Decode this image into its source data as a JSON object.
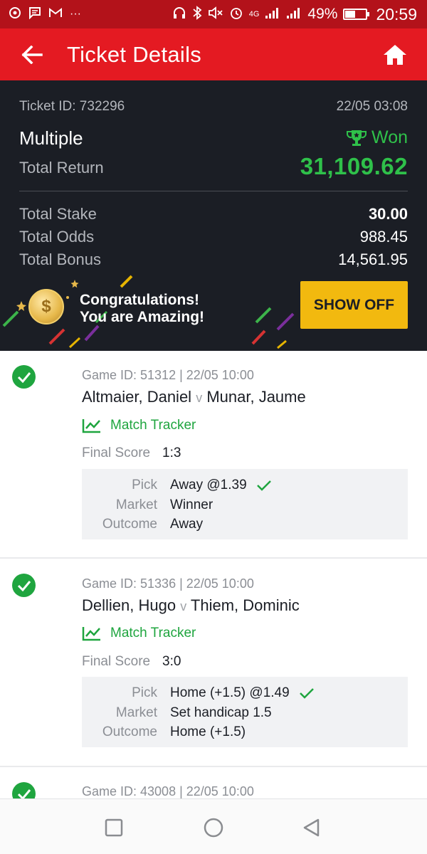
{
  "status_bar": {
    "network": "4G",
    "battery_pct": "49%",
    "battery_level": 0.49,
    "time": "20:59",
    "icons_left": [
      "sync-icon",
      "message-icon",
      "gmail-icon",
      "more-icon"
    ],
    "icons_right": [
      "headset-icon",
      "bluetooth-icon",
      "mute-icon",
      "alarm-icon",
      "signal-icon",
      "signal-icon",
      "battery-icon"
    ]
  },
  "header": {
    "title": "Ticket Details",
    "back_icon": "arrow-left-icon",
    "home_icon": "home-icon"
  },
  "ticket": {
    "id_label": "Ticket ID: 732296",
    "datetime": "22/05 03:08",
    "bet_type": "Multiple",
    "status": "Won",
    "status_icon": "trophy-icon",
    "total_return_label": "Total Return",
    "total_return": "31,109.62",
    "total_stake_label": "Total Stake",
    "total_stake": "30.00",
    "total_odds_label": "Total Odds",
    "total_odds": "988.45",
    "total_bonus_label": "Total Bonus",
    "total_bonus": "14,561.95"
  },
  "banner": {
    "line1": "Congratulations!",
    "line2": "You are Amazing!",
    "button": "SHOW OFF",
    "coin_icon": "coin-icon"
  },
  "colors": {
    "brand_red": "#e41a22",
    "dark_bg": "#1b1e25",
    "won_green": "#2fc14a",
    "accent_yellow": "#f2b90f"
  },
  "selections": [
    {
      "game_id": "Game ID: 51312 | 22/05 10:00",
      "home": "Altmaier, Daniel",
      "vs": "v",
      "away": "Munar, Jaume",
      "tracker": "Match Tracker",
      "final_score_label": "Final Score",
      "final_score": "1:3",
      "pick_label": "Pick",
      "pick": "Away @1.39",
      "market_label": "Market",
      "market": "Winner",
      "outcome_label": "Outcome",
      "outcome": "Away"
    },
    {
      "game_id": "Game ID: 51336 | 22/05 10:00",
      "home": "Dellien, Hugo",
      "vs": "v",
      "away": "Thiem, Dominic",
      "tracker": "Match Tracker",
      "final_score_label": "Final Score",
      "final_score": "3:0",
      "pick_label": "Pick",
      "pick": "Home (+1.5) @1.49",
      "market_label": "Market",
      "market": "Set handicap 1.5",
      "outcome_label": "Outcome",
      "outcome": "Home (+1.5)"
    },
    {
      "game_id": "Game ID: 43008 | 22/05 10:00"
    }
  ],
  "nav_bar": {
    "buttons": [
      "recents-icon",
      "home-circle-icon",
      "back-triangle-icon"
    ]
  }
}
